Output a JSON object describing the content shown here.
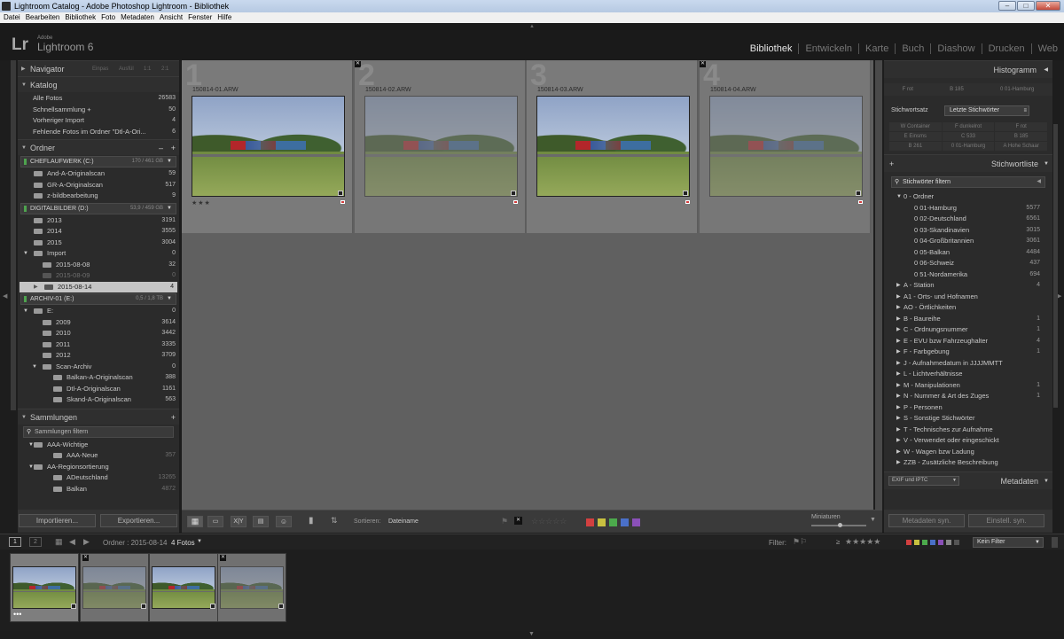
{
  "window": {
    "title": "Lightroom Catalog - Adobe Photoshop Lightroom - Bibliothek",
    "controls": [
      "–",
      "□",
      "✕"
    ]
  },
  "menu": [
    "Datei",
    "Bearbeiten",
    "Bibliothek",
    "Foto",
    "Metadaten",
    "Ansicht",
    "Fenster",
    "Hilfe"
  ],
  "identity": {
    "logo": "Lr",
    "adobe": "Adobe",
    "product": "Lightroom 6"
  },
  "modules": [
    "Bibliothek",
    "Entwickeln",
    "Karte",
    "Buch",
    "Diashow",
    "Drucken",
    "Web"
  ],
  "left": {
    "navigator": {
      "title": "Navigator",
      "options": [
        "Einpas",
        "Ausfül",
        "1:1",
        "2:1"
      ]
    },
    "katalog": {
      "title": "Katalog",
      "items": [
        {
          "label": "Alle Fotos",
          "count": "26583"
        },
        {
          "label": "Schnellsammlung +",
          "count": "50"
        },
        {
          "label": "Vorheriger Import",
          "count": "4"
        },
        {
          "label": "Fehlende Fotos im Ordner \"Dtl-A-Ori...",
          "count": "6"
        }
      ]
    },
    "ordner": {
      "title": "Ordner",
      "add": "+",
      "minus": "–",
      "vol1": {
        "label": "CHEFLAUFWERK (C:)",
        "cap": "170 / 461 GB"
      },
      "vol1_items": [
        {
          "label": "And-A-Originalscan",
          "count": "59"
        },
        {
          "label": "GR-A-Originalscan",
          "count": "517"
        },
        {
          "label": "z-bildbearbeitung",
          "count": "9"
        }
      ],
      "vol2": {
        "label": "DIGITALBILDER (D:)",
        "cap": "53,9 / 459 GB"
      },
      "vol2_items": [
        {
          "label": "2013",
          "count": "3191"
        },
        {
          "label": "2014",
          "count": "3555"
        },
        {
          "label": "2015",
          "count": "3004"
        },
        {
          "label": "Import",
          "count": "0"
        },
        {
          "label": "2015-08-08",
          "count": "32"
        },
        {
          "label": "2015-08-09",
          "count": "0"
        },
        {
          "label": "2015-08-14",
          "count": "4"
        }
      ],
      "vol3": {
        "label": "ARCHIV-01 (E:)",
        "cap": "0,5 / 1,8 TB"
      },
      "vol3_items": [
        {
          "label": "E:",
          "count": "0"
        },
        {
          "label": "2009",
          "count": "3614"
        },
        {
          "label": "2010",
          "count": "3442"
        },
        {
          "label": "2011",
          "count": "3335"
        },
        {
          "label": "2012",
          "count": "3709"
        },
        {
          "label": "Scan-Archiv",
          "count": "0"
        },
        {
          "label": "Balkan-A-Originalscan",
          "count": "388"
        },
        {
          "label": "Dtl-A-Originalscan",
          "count": "1161"
        },
        {
          "label": "Skand-A-Originalscan",
          "count": "563"
        }
      ]
    },
    "sammlungen": {
      "title": "Sammlungen",
      "add": "+",
      "filter": "Sammlungen filtern",
      "items": [
        {
          "label": "AAA-Wichtige",
          "count": ""
        },
        {
          "label": "AAA-Neue",
          "count": "357"
        },
        {
          "label": "AA-Regionsortierung",
          "count": ""
        },
        {
          "label": "ADeutschland",
          "count": "13265"
        },
        {
          "label": "Balkan",
          "count": "4872"
        }
      ]
    },
    "import_btn": "Importieren...",
    "export_btn": "Exportieren..."
  },
  "grid": {
    "cells": [
      {
        "num": "1",
        "file": "150814-01.ARW",
        "stars": "★★★"
      },
      {
        "num": "2",
        "file": "150814-02.ARW",
        "stars": ""
      },
      {
        "num": "3",
        "file": "150814-03.ARW",
        "stars": ""
      },
      {
        "num": "4",
        "file": "150814-04.ARW",
        "stars": ""
      }
    ]
  },
  "toolbar": {
    "sort_label": "Sortieren:",
    "sort_value": "Dateiname",
    "thumb_label": "Miniaturen",
    "empty_stars": "☆☆☆☆☆",
    "grid_icon": "grid-icon",
    "loupe_icon": "loupe-icon",
    "compare_label": "X|Y",
    "survey_icon": "survey-icon",
    "people_icon": "people-icon",
    "spray_icon": "spray-can-icon",
    "sort_icon": "sort-direction-icon"
  },
  "filmbar": {
    "view1": "1",
    "view2": "2",
    "source": "Ordner : 2015-08-14",
    "count": "4 Fotos",
    "filter_label": "Filter:",
    "ge": "≥",
    "stars": "★★★★★",
    "filter_value": "Kein Filter"
  },
  "filmstrip": {
    "stars": "•••"
  },
  "right": {
    "histogramm": "Histogramm",
    "topgrid": [
      "F rot",
      "B 185",
      "0 01-Hamburg"
    ],
    "kwset_label": "Stichwortsatz",
    "kwset_value": "Letzte Stichwörter",
    "kwgrid": [
      "W Container",
      "F dunkelrot",
      "F rot",
      "E Einsms",
      "C 533",
      "B 185",
      "B 261",
      "0 01-Hamburg",
      "A Hohe Schaar"
    ],
    "stichwortliste": "Stichwortliste",
    "add": "+",
    "filter": "Stichwörter filtern",
    "keywords": [
      {
        "label": "0 - Ordner",
        "count": "",
        "indent": 1
      },
      {
        "label": "0 01-Hamburg",
        "count": "5577",
        "indent": 2
      },
      {
        "label": "0 02-Deutschland",
        "count": "6561",
        "indent": 2
      },
      {
        "label": "0 03-Skandinavien",
        "count": "3015",
        "indent": 2
      },
      {
        "label": "0 04-Großbritannien",
        "count": "3061",
        "indent": 2
      },
      {
        "label": "0 05-Balkan",
        "count": "4484",
        "indent": 2
      },
      {
        "label": "0 06-Schweiz",
        "count": "437",
        "indent": 2
      },
      {
        "label": "0 51-Nordamerika",
        "count": "694",
        "indent": 2
      },
      {
        "label": "A - Station",
        "count": "4",
        "indent": 1
      },
      {
        "label": "A1 - Orts- und Hofnamen",
        "count": "",
        "indent": 1
      },
      {
        "label": "AO - Örtlichkeiten",
        "count": "",
        "indent": 1
      },
      {
        "label": "B - Baureihe",
        "count": "1",
        "indent": 1
      },
      {
        "label": "C - Ordnungsnummer",
        "count": "1",
        "indent": 1
      },
      {
        "label": "E - EVU bzw Fahrzeughalter",
        "count": "4",
        "indent": 1
      },
      {
        "label": "F - Farbgebung",
        "count": "1",
        "indent": 1
      },
      {
        "label": "J - Aufnahmedatum in JJJJMMTT",
        "count": "",
        "indent": 1
      },
      {
        "label": "L - Lichtverhältnisse",
        "count": "",
        "indent": 1
      },
      {
        "label": "M - Manipulationen",
        "count": "1",
        "indent": 1
      },
      {
        "label": "N - Nummer & Art des Zuges",
        "count": "1",
        "indent": 1
      },
      {
        "label": "P - Personen",
        "count": "",
        "indent": 1
      },
      {
        "label": "S - Sonstige Stichwörter",
        "count": "",
        "indent": 1
      },
      {
        "label": "T - Technisches zur Aufnahme",
        "count": "",
        "indent": 1
      },
      {
        "label": "V - Verwendet oder eingeschickt",
        "count": "",
        "indent": 1
      },
      {
        "label": "W - Wagen bzw Ladung",
        "count": "",
        "indent": 1
      },
      {
        "label": "ZZB - Zusätzliche Beschreibung",
        "count": "",
        "indent": 1
      }
    ],
    "metadaten_preset": "EXIF und IPTC",
    "metadaten": "Metadaten",
    "sync_meta": "Metadaten syn.",
    "sync_settings": "Einstell. syn."
  },
  "colors": {
    "accent_red": "#d43c3c",
    "label_colors": [
      "#d24040",
      "#c8c040",
      "#4caa4c",
      "#4a70c8",
      "#8a50b8"
    ]
  }
}
